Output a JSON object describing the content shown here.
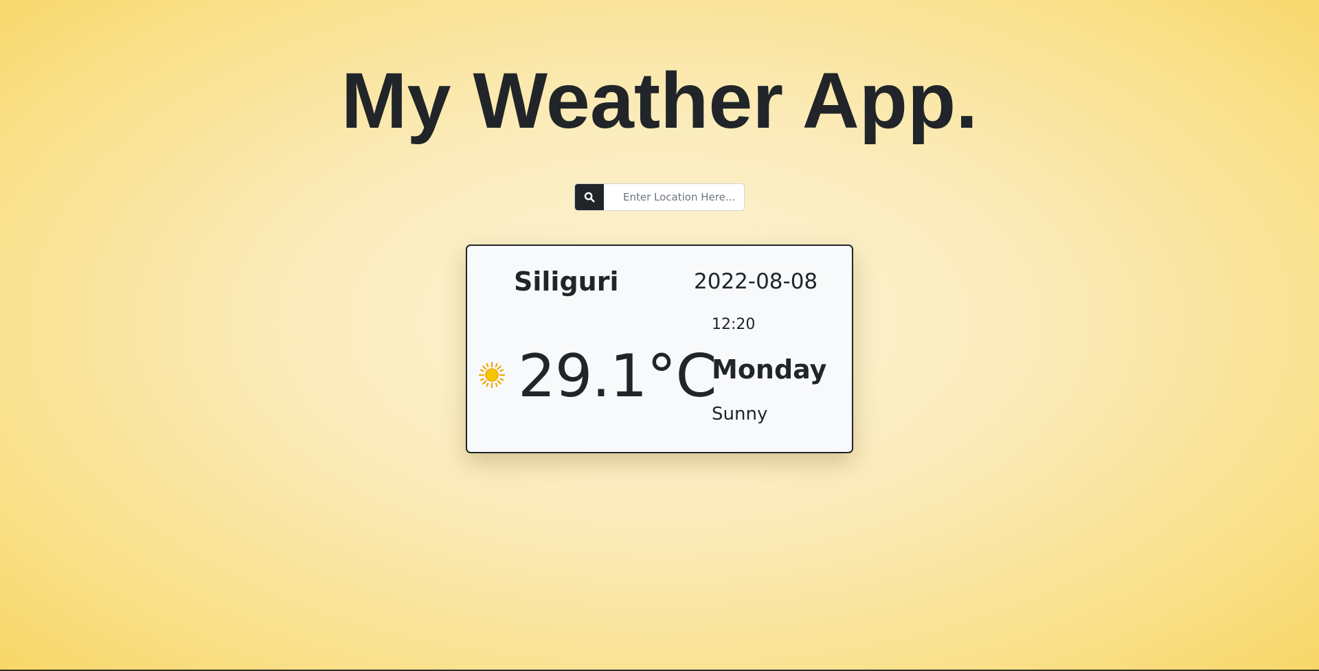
{
  "header": {
    "title": "My Weather App."
  },
  "search": {
    "placeholder": "Enter Location Here...",
    "value": "",
    "button_icon": "search-icon"
  },
  "weather": {
    "city": "Siliguri",
    "date": "2022-08-08",
    "time": "12:20",
    "temperature": "29.1°C",
    "day": "Monday",
    "condition": "Sunny",
    "condition_icon": "sun-icon"
  },
  "colors": {
    "text": "#212529",
    "card_background": "#f8f9fa",
    "search_button": "#212529",
    "sun_fill": "#f5c400",
    "sun_rays": "#f0a500",
    "background_center": "#fdf3d4",
    "background_edge": "#f7d45c"
  }
}
